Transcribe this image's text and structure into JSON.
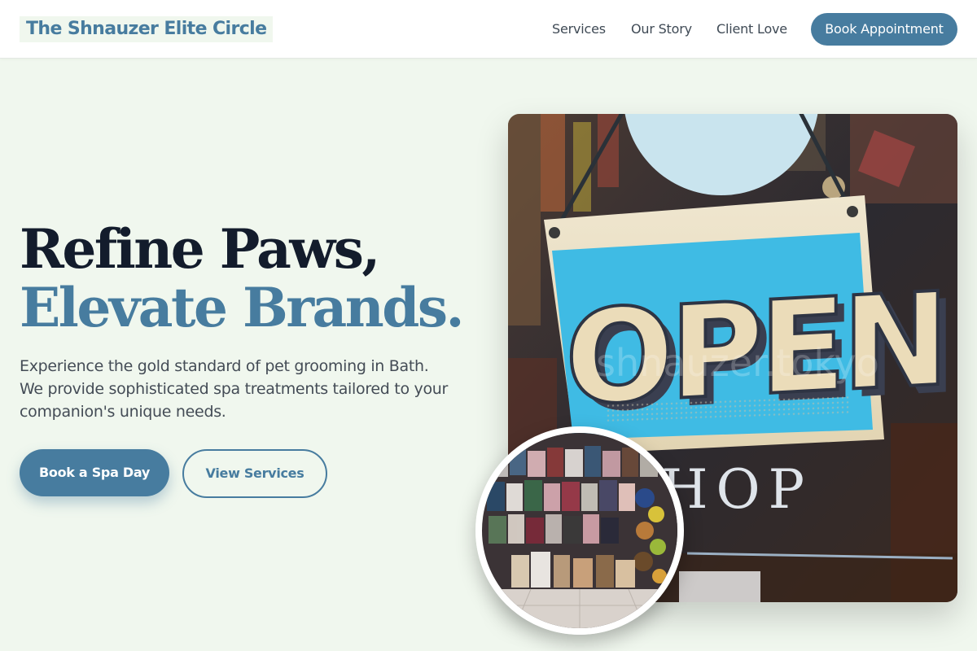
{
  "header": {
    "brand": "The Shnauzer Elite Circle",
    "nav": [
      "Services",
      "Our Story",
      "Client Love"
    ],
    "cta": "Book Appointment"
  },
  "hero": {
    "headline_line1": "Refine Paws,",
    "headline_line2": "Elevate Brands.",
    "lead": "Experience the gold standard of pet grooming in Bath. We provide sophisticated spa treatments tailored to your companion's unique needs.",
    "primary_button": "Book a Spa Day",
    "secondary_button": "View Services"
  },
  "photo": {
    "sign_text": "OPEN",
    "window_text": "HOP",
    "watermark": "shnauzer.tokyo"
  },
  "colors": {
    "accent": "#477c9f",
    "heading_dark": "#131c2c",
    "page_background": "#f0f7ee",
    "sign_blue": "#3fbbe4"
  }
}
